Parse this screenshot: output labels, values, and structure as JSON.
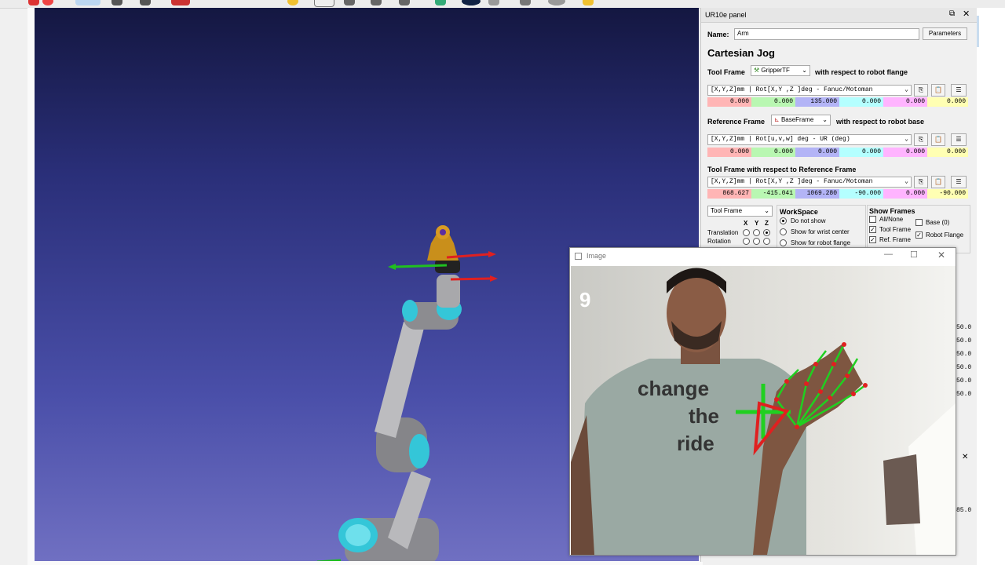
{
  "panel": {
    "title": "UR10e panel",
    "name_label": "Name:",
    "name_value": "Arm",
    "parameters_button": "Parameters",
    "section_title": "Cartesian Jog",
    "tool_frame_label": "Tool Frame",
    "tool_frame_value": "GripperTF",
    "tool_frame_suffix": "with respect to robot flange",
    "tool_format": "[X,Y,Z]mm | Rot[X,Y ,Z  ]deg - Fanuc/Motoman",
    "tool_values": [
      "0.000",
      "0.000",
      "135.000",
      "0.000",
      "0.000",
      "0.000"
    ],
    "ref_frame_label": "Reference Frame",
    "ref_frame_value": "BaseFrame",
    "ref_frame_suffix": "with respect to robot base",
    "ref_format": "[X,Y,Z]mm | Rot[u,v,w] deg   - UR (deg)",
    "ref_values": [
      "0.000",
      "0.000",
      "0.000",
      "0.000",
      "0.000",
      "0.000"
    ],
    "tool_ref_title": "Tool Frame with respect to Reference Frame",
    "toolref_format": "[X,Y,Z]mm | Rot[X,Y ,Z  ]deg - Fanuc/Motoman",
    "toolref_values": [
      "868.627",
      "-415.041",
      "1069.280",
      "-90.000",
      "0.000",
      "-90.000"
    ],
    "jog_frame_value": "Tool Frame",
    "xyz_labels": [
      "X",
      "Y",
      "Z"
    ],
    "translation_label": "Translation",
    "rotation_label": "Rotation",
    "workspace_title": "WorkSpace",
    "workspace_options": [
      "Do not show",
      "Show for wrist center",
      "Show for robot flange"
    ],
    "show_frames_title": "Show Frames",
    "show_frames_options": [
      "All/None",
      "Base (0)",
      "Tool Frame",
      "Robot Flange",
      "Ref. Frame"
    ],
    "hidden_values": [
      "50.0",
      "50.0",
      "50.0",
      "50.0",
      "50.0",
      "50.0",
      "85.0"
    ]
  },
  "image_window": {
    "title": "Image",
    "gesture_count": "9",
    "shirt_text": [
      "change",
      "the",
      "ride"
    ]
  }
}
